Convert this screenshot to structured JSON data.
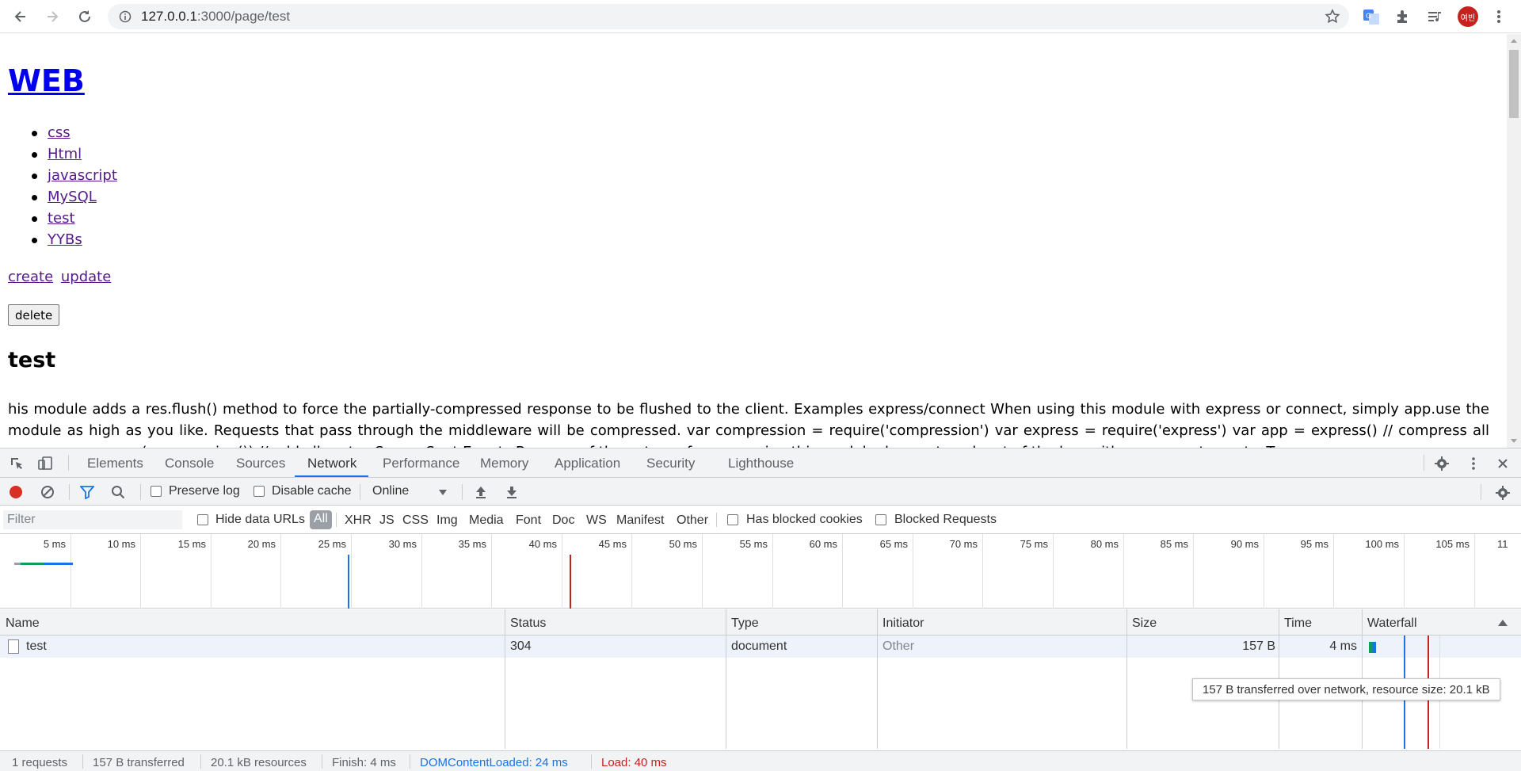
{
  "browser": {
    "url_host": "127.0.0.1",
    "url_rest": ":3000/page/test",
    "avatar_text": "여빈",
    "icons": [
      "back-icon",
      "forward-icon",
      "reload-icon",
      "info-icon",
      "star-icon",
      "translate-icon",
      "extensions-icon",
      "reading-list-icon",
      "menu-icon"
    ]
  },
  "page": {
    "title": "WEB",
    "topics": [
      "css",
      "Html",
      "javascript",
      "MySQL",
      "test",
      "YYBs"
    ],
    "create_label": "create",
    "update_label": "update",
    "delete_label": "delete",
    "heading": "test",
    "description": "his module adds a res.flush() method to force the partially-compressed response to be flushed to the client. Examples express/connect When using this module with express or connect, simply app.use the module as high as you like. Requests that pass through the middleware will be compressed. var compression = require('compression') var express = require('express') var app = express() // compress all responses app.use(compression()) // add all routes Server-Sent Events Because of the nature of compression this module does not work out of the box with server-sent events. To"
  },
  "devtools": {
    "tabs": [
      "Elements",
      "Console",
      "Sources",
      "Network",
      "Performance",
      "Memory",
      "Application",
      "Security",
      "Lighthouse"
    ],
    "active_tab": "Network",
    "toolbar": {
      "preserve_log": "Preserve log",
      "disable_cache": "Disable cache",
      "throttling": "Online"
    },
    "filter": {
      "placeholder": "Filter",
      "hide_data_urls": "Hide data URLs",
      "types": [
        "All",
        "XHR",
        "JS",
        "CSS",
        "Img",
        "Media",
        "Font",
        "Doc",
        "WS",
        "Manifest",
        "Other"
      ],
      "has_blocked_cookies": "Has blocked cookies",
      "blocked_requests": "Blocked Requests"
    },
    "overview_ticks": [
      "5 ms",
      "10 ms",
      "15 ms",
      "20 ms",
      "25 ms",
      "30 ms",
      "35 ms",
      "40 ms",
      "45 ms",
      "50 ms",
      "55 ms",
      "60 ms",
      "65 ms",
      "70 ms",
      "75 ms",
      "80 ms",
      "85 ms",
      "90 ms",
      "95 ms",
      "100 ms",
      "105 ms",
      "11"
    ],
    "columns": [
      "Name",
      "Status",
      "Type",
      "Initiator",
      "Size",
      "Time",
      "Waterfall"
    ],
    "rows": [
      {
        "name": "test",
        "status": "304",
        "type": "document",
        "initiator": "Other",
        "size": "157 B",
        "time": "4 ms"
      }
    ],
    "tooltip": "157 B transferred over network, resource size: 20.1 kB",
    "summary": {
      "requests": "1 requests",
      "transferred": "157 B transferred",
      "resources": "20.1 kB resources",
      "finish": "Finish: 4 ms",
      "dom_content_loaded": "DOMContentLoaded: 24 ms",
      "load": "Load: 40 ms"
    },
    "colors": {
      "dom_content_loaded": "#1a73e8",
      "load": "#c5221f",
      "record": "#d93025"
    }
  }
}
